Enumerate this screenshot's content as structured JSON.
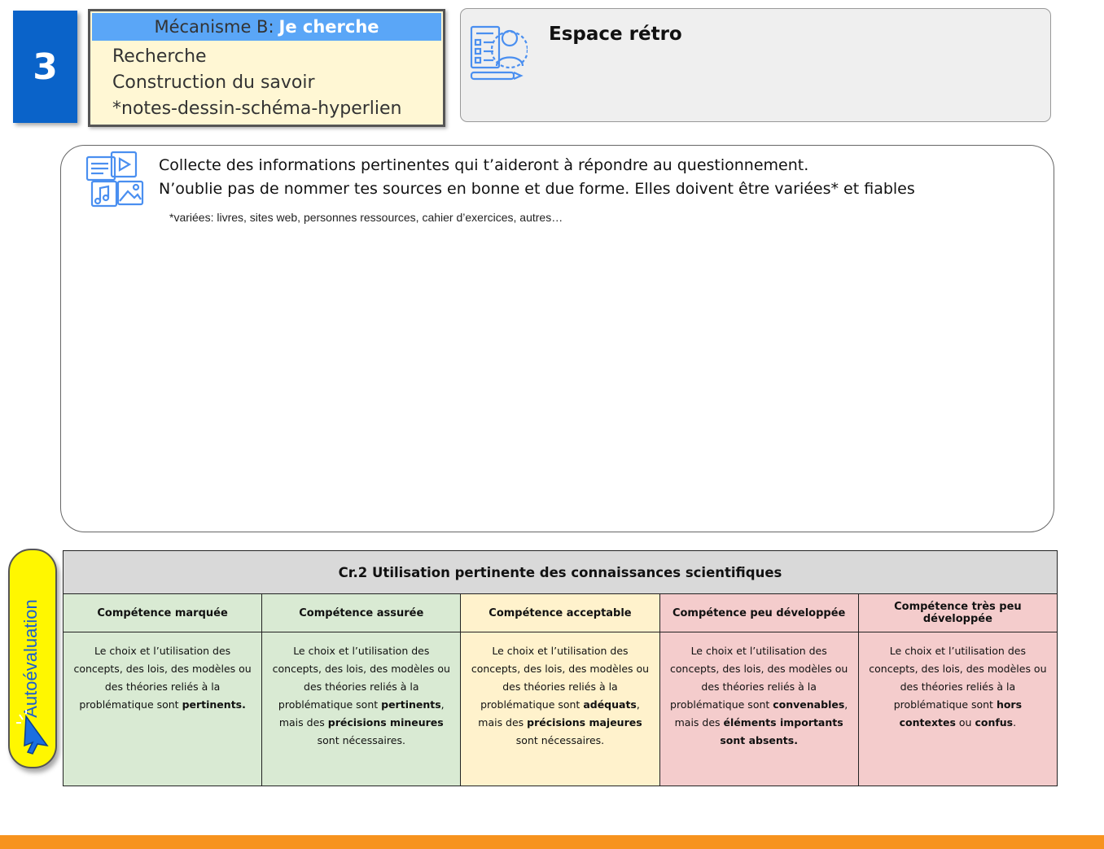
{
  "step": {
    "number": "3"
  },
  "mechanism": {
    "title_prefix": "Mécanisme B:",
    "title_highlight": "Je cherche",
    "lines": [
      "Recherche",
      "Construction du savoir",
      "*notes-dessin-schéma-hyperlien"
    ]
  },
  "retro": {
    "title": "Espace rétro",
    "icon": "checklist-person-icon"
  },
  "collect": {
    "icon": "media-collection-icon",
    "line1": "Collecte des informations pertinentes qui t’aideront à répondre au questionnement.",
    "line2": "N’oublie pas de nommer tes sources en bonne et due forme. Elles doivent être variées* et fiables",
    "note": "*variées: livres, sites web, personnes ressources, cahier d’exercices, autres…"
  },
  "autoevaluation": {
    "label": "Autoévaluation",
    "icon": "cursor-click-icon"
  },
  "rubric": {
    "title": "Cr.2 Utilisation pertinente des connaissances scientifiques",
    "levels": [
      {
        "label": "Compétence marquée",
        "color": "#d9ead3",
        "d1": "Le choix et l’utilisation des concepts, des lois, des modèles ou des théories reliés à la problématique sont ",
        "b1": "pertinents.",
        "d2": "",
        "b2": "",
        "d3": "",
        "b3": "",
        "d4": ""
      },
      {
        "label": "Compétence assurée",
        "color": "#d9ead3",
        "d1": "Le choix et l’utilisation des concepts, des lois, des modèles ou des théories reliés à la problématique  sont ",
        "b1": "pertinents",
        "d2": ", mais des ",
        "b2": "précisions mineures",
        "d3": " sont nécessaires.",
        "b3": "",
        "d4": ""
      },
      {
        "label": "Compétence acceptable",
        "color": "#fff2cc",
        "d1": "Le choix et l’utilisation des concepts, des lois, des modèles ou des théories reliés à la problématique sont ",
        "b1": "adéquats",
        "d2": ", mais des ",
        "b2": "précisions majeures",
        "d3": " sont nécessaires.",
        "b3": "",
        "d4": ""
      },
      {
        "label": "Compétence peu développée",
        "color": "#f4cccc",
        "d1": "Le choix et l’utilisation des concepts, des lois, des modèles ou des théories reliés à la problématique sont ",
        "b1": "convenables",
        "d2": ", mais des ",
        "b2": "éléments importants sont absents.",
        "d3": "",
        "b3": "",
        "d4": ""
      },
      {
        "label": "Compétence très peu développée",
        "color": "#f4cccc",
        "d1": "Le choix et l’utilisation des concepts, des lois, des modèles ou des théories reliés à la problématique sont ",
        "b1": "hors contextes",
        "d2": " ou ",
        "b2": "confus",
        "d3": ".",
        "b3": "",
        "d4": ""
      }
    ]
  },
  "footer": {
    "bar_color": "#f7931e"
  }
}
